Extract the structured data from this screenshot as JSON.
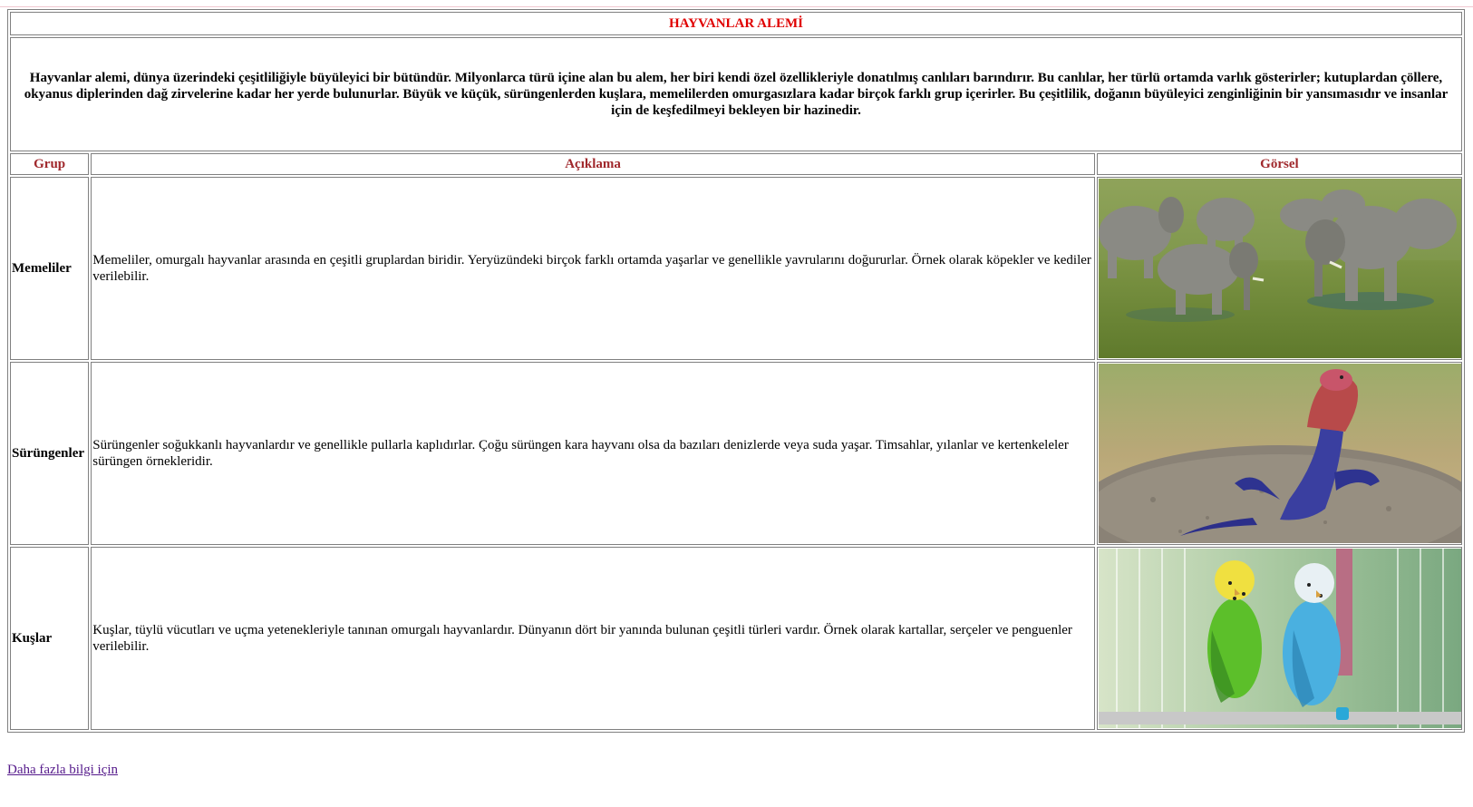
{
  "page": {
    "title": "HAYVANLAR ALEMİ",
    "intro_lines": [
      "Hayvanlar alemi, dünya üzerindeki çeşitliliğiyle büyüleyici bir bütündür. Milyonlarca türü içine alan bu alem, her biri kendi özel özellikleriyle donatılmış canlıları barındırır. Bu canlılar, her türlü ortamda varlık gösterirler; kutuplardan çöllere,",
      "okyanus diplerinden dağ zirvelerine kadar her yerde bulunurlar. Büyük ve küçük, sürüngenlerden kuşlara, memelilerden omurgasızlara kadar birçok farklı grup içerirler. Bu çeşitlilik, doğanın büyüleyici zenginliğinin bir yansımasıdır ve insanlar",
      "için de keşfedilmeyi bekleyen bir hazinedir."
    ]
  },
  "table": {
    "headers": {
      "group": "Grup",
      "description": "Açıklama",
      "image": "Görsel"
    },
    "rows": [
      {
        "group": "Memeliler",
        "description": "Memeliler, omurgalı hayvanlar arasında en çeşitli gruplardan biridir. Yeryüzündeki birçok farklı ortamda yaşarlar ve genellikle yavrularını doğururlar. Örnek olarak köpekler ve kediler verilebilir.",
        "image": "elephants-photo"
      },
      {
        "group": "Sürüngenler",
        "description": "Sürüngenler soğukkanlı hayvanlardır ve genellikle pullarla kaplıdırlar. Çoğu sürüngen kara hayvanı olsa da bazıları denizlerde veya suda yaşar. Timsahlar, yılanlar ve kertenkeleler sürüngen örnekleridir.",
        "image": "agama-lizard-photo"
      },
      {
        "group": "Kuşlar",
        "description": "Kuşlar, tüylü vücutları ve uçma yetenekleriyle tanınan omurgalı hayvanlardır. Dünyanın dört bir yanında bulunan çeşitli türleri vardır. Örnek olarak kartallar, serçeler ve penguenler verilebilir.",
        "image": "budgerigars-photo"
      }
    ]
  },
  "footer": {
    "link_text": "Daha fazla bilgi için"
  },
  "colors": {
    "title": "#e00000",
    "header": "#a0282c",
    "link": "#551a8b",
    "border": "#808080"
  }
}
